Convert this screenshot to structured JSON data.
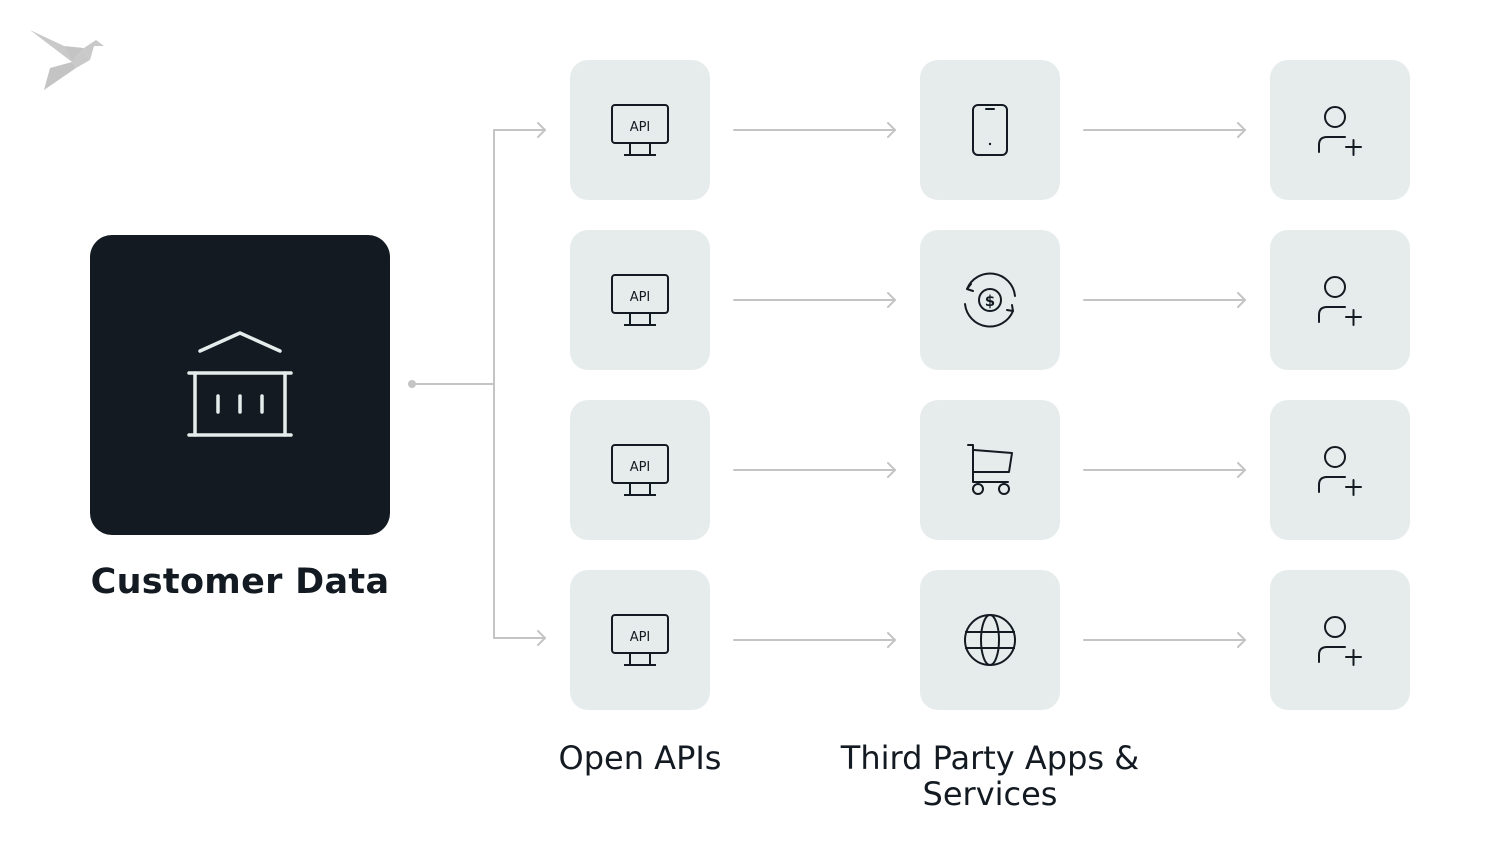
{
  "diagram": {
    "type": "data-flow",
    "colors": {
      "source_fill": "#131a21",
      "source_icon": "#e6ecec",
      "tile_fill": "#e6ecec",
      "icon_stroke": "#131a21",
      "connector": "#c4c4c4",
      "logo": "#c9c9c9",
      "text": "#131a21"
    },
    "logo": {
      "icon": "origami-bird-logo"
    },
    "source": {
      "label": "Customer Data",
      "icon": "bank-icon"
    },
    "columns": [
      {
        "label": "Open APIs"
      },
      {
        "label": "Third Party Apps & Services"
      },
      {
        "label": ""
      }
    ],
    "rows": [
      {
        "api": {
          "icon": "api-monitor-icon",
          "text": "API"
        },
        "service": {
          "icon": "smartphone-icon"
        },
        "user": {
          "icon": "add-user-icon"
        }
      },
      {
        "api": {
          "icon": "api-monitor-icon",
          "text": "API"
        },
        "service": {
          "icon": "currency-exchange-icon"
        },
        "user": {
          "icon": "add-user-icon"
        }
      },
      {
        "api": {
          "icon": "api-monitor-icon",
          "text": "API"
        },
        "service": {
          "icon": "shopping-cart-icon"
        },
        "user": {
          "icon": "add-user-icon"
        }
      },
      {
        "api": {
          "icon": "api-monitor-icon",
          "text": "API"
        },
        "service": {
          "icon": "globe-icon"
        },
        "user": {
          "icon": "add-user-icon"
        }
      }
    ],
    "edges": [
      {
        "from": "source",
        "to": "row-1-api"
      },
      {
        "from": "source",
        "to": "row-4-api"
      },
      {
        "from": "row-1-api",
        "to": "row-1-service"
      },
      {
        "from": "row-2-api",
        "to": "row-2-service"
      },
      {
        "from": "row-3-api",
        "to": "row-3-service"
      },
      {
        "from": "row-4-api",
        "to": "row-4-service"
      },
      {
        "from": "row-1-service",
        "to": "row-1-user"
      },
      {
        "from": "row-2-service",
        "to": "row-2-user"
      },
      {
        "from": "row-3-service",
        "to": "row-3-user"
      },
      {
        "from": "row-4-service",
        "to": "row-4-user"
      }
    ]
  }
}
